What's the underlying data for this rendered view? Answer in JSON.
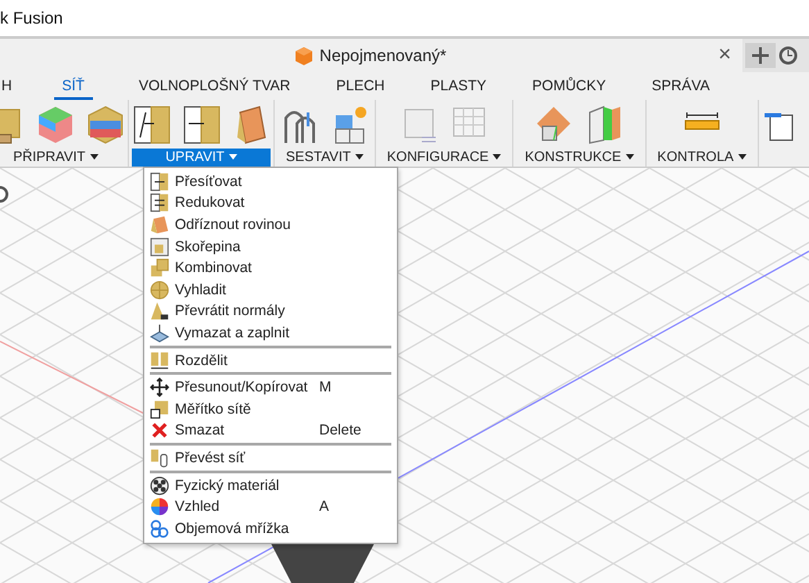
{
  "title_bar": {
    "title": "k Fusion"
  },
  "document_tab": {
    "title": "Nepojmenovaný*",
    "close": "×"
  },
  "ribbon_tabs": [
    {
      "label": "H",
      "selected": false
    },
    {
      "label": "SÍŤ",
      "selected": true
    },
    {
      "label": "VOLNOPLOŠNÝ TVAR",
      "selected": false
    },
    {
      "label": "PLECH",
      "selected": false
    },
    {
      "label": "PLASTY",
      "selected": false
    },
    {
      "label": "POMŮCKY",
      "selected": false
    },
    {
      "label": "SPRÁVA",
      "selected": false
    }
  ],
  "tool_groups": [
    {
      "label": "PŘIPRAVIT",
      "selected": false
    },
    {
      "label": "UPRAVIT",
      "selected": true
    },
    {
      "label": "SESTAVIT",
      "selected": false
    },
    {
      "label": "KONFIGURACE",
      "selected": false
    },
    {
      "label": "KONSTRUKCE",
      "selected": false
    },
    {
      "label": "KONTROLA",
      "selected": false
    }
  ],
  "menu": {
    "sections": [
      {
        "items": [
          {
            "label": "Přesíťovat"
          },
          {
            "label": "Redukovat"
          },
          {
            "label": "Odříznout rovinou"
          },
          {
            "label": "Skořepina"
          },
          {
            "label": "Kombinovat"
          },
          {
            "label": "Vyhladit"
          },
          {
            "label": "Převrátit normály"
          },
          {
            "label": "Vymazat a zaplnit"
          }
        ]
      },
      {
        "items": [
          {
            "label": "Rozdělit"
          }
        ]
      },
      {
        "items": [
          {
            "label": "Přesunout/Kopírovat",
            "shortcut": "M"
          },
          {
            "label": "Měřítko sítě"
          },
          {
            "label": "Smazat",
            "shortcut": "Delete"
          }
        ]
      },
      {
        "items": [
          {
            "label": "Převést síť"
          }
        ]
      },
      {
        "items": [
          {
            "label": "Fyzický materiál"
          },
          {
            "label": "Vzhled",
            "shortcut": "A"
          },
          {
            "label": "Objemová mřížka"
          }
        ]
      }
    ]
  }
}
